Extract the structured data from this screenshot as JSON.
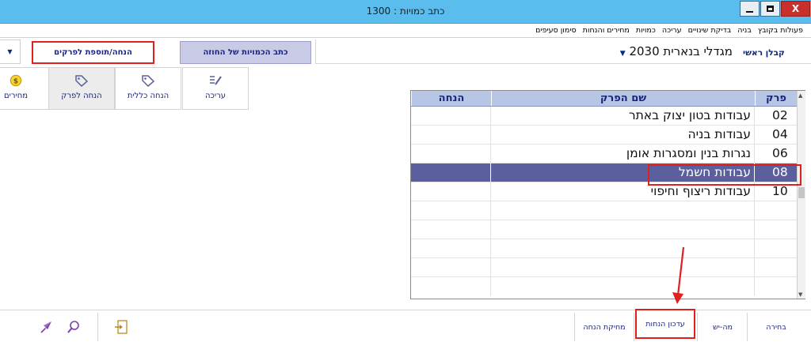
{
  "window": {
    "title": "כתב כמויות : 1300",
    "close_symbol": "X"
  },
  "menu": {
    "items": [
      "פעולות בקובץ",
      "בניה",
      "בדיקת שינויים",
      "עריכה",
      "כמויות",
      "מחירים והנחות",
      "סימון סעיפים"
    ]
  },
  "toolbar": {
    "contractor_label": "קבלן ראשי",
    "project_value": "מגדלי בנארית 2030",
    "write_qty_button": "כתב הכמויות של החוזה",
    "discount_add_button": "הנחה/תוספת לפרקים"
  },
  "ribbon": {
    "tabs": [
      {
        "label": "עריכה",
        "icon": "edit-icon",
        "active": false
      },
      {
        "label": "הנחה כללית",
        "icon": "tag-icon",
        "active": false
      },
      {
        "label": "הנחה לפרק",
        "icon": "tag-icon",
        "active": true
      },
      {
        "label": "מחירים",
        "icon": "dollar-coin-icon",
        "active": false
      }
    ]
  },
  "grid": {
    "columns": [
      "הנחה",
      "שם הפרק",
      "פרק"
    ],
    "rows": [
      {
        "chapter": "02",
        "name": "עבודות בטון יצוק באתר",
        "discount": "",
        "selected": false
      },
      {
        "chapter": "04",
        "name": "עבודות בניה",
        "discount": "",
        "selected": false
      },
      {
        "chapter": "06",
        "name": "נגרות בנין ומסגרות אומן",
        "discount": "",
        "selected": false
      },
      {
        "chapter": "08",
        "name": "עבודות חשמל",
        "discount": "",
        "selected": true
      },
      {
        "chapter": "10",
        "name": "עבודות ריצוף וחיפוי",
        "discount": "",
        "selected": false
      }
    ]
  },
  "bottom": {
    "select_button": "בחירה",
    "mayesh_button": "מה-יש",
    "update_discount_button": "עדכון הנחות",
    "delete_discount_button": "מחיקת הנחה"
  },
  "colors": {
    "titlebar": "#5bbdee",
    "selected_row": "#5b5f9e",
    "grid_header": "#b8c6e6",
    "highlight_red": "#e02020",
    "label_navy": "#1a237e"
  }
}
